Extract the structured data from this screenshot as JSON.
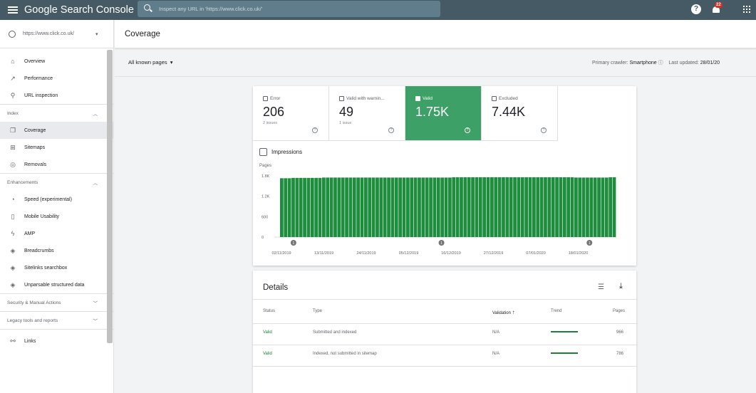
{
  "topbar": {
    "app_title": "Google Search Console",
    "search_placeholder": "Inspect any URL in 'https://www.click.co.uk/'",
    "notification_count": "22"
  },
  "sidebar": {
    "property": "https://www.click.co.uk/",
    "items_top": [
      {
        "label": "Overview",
        "icon": "home-icon",
        "glyph": "⌂"
      },
      {
        "label": "Performance",
        "icon": "trending-up-icon",
        "glyph": "↗"
      },
      {
        "label": "URL inspection",
        "icon": "search-icon",
        "glyph": "⚲"
      }
    ],
    "index_section": "Index",
    "index_items": [
      {
        "label": "Coverage",
        "icon": "file-copy-icon",
        "glyph": "❐",
        "active": true
      },
      {
        "label": "Sitemaps",
        "icon": "sitemap-icon",
        "glyph": "⊞"
      },
      {
        "label": "Removals",
        "icon": "visibility-off-icon",
        "glyph": "◎"
      }
    ],
    "enhancements_section": "Enhancements",
    "enhancement_items": [
      {
        "label": "Speed (experimental)",
        "icon": "speed-icon",
        "glyph": "◔"
      },
      {
        "label": "Mobile Usability",
        "icon": "phone-icon",
        "glyph": "▯"
      },
      {
        "label": "AMP",
        "icon": "bolt-icon",
        "glyph": "ϟ"
      },
      {
        "label": "Breadcrumbs",
        "icon": "layers-icon",
        "glyph": "◈"
      },
      {
        "label": "Sitelinks searchbox",
        "icon": "layers-icon",
        "glyph": "◈"
      },
      {
        "label": "Unparsable structured data",
        "icon": "layers-icon",
        "glyph": "◈"
      }
    ],
    "security_section": "Security & Manual Actions",
    "legacy_section": "Legacy tools and reports",
    "links_label": "Links"
  },
  "header": {
    "title": "Coverage"
  },
  "filter": {
    "pages_select": "All known pages",
    "crawler_label": "Primary crawler:",
    "crawler_value": "Smartphone",
    "last_updated_label": "Last updated:",
    "last_updated_value": "28/01/20"
  },
  "tiles": [
    {
      "label": "Error",
      "value": "206",
      "sub": "2 issues",
      "selected": false
    },
    {
      "label": "Valid with warnin...",
      "value": "49",
      "sub": "1 issue",
      "selected": false
    },
    {
      "label": "Valid",
      "value": "1.75K",
      "sub": "",
      "selected": true
    },
    {
      "label": "Excluded",
      "value": "7.44K",
      "sub": "",
      "selected": false
    }
  ],
  "impressions_label": "Impressions",
  "chart_data": {
    "type": "bar",
    "ylabel": "Pages",
    "yticks": [
      "1.8K",
      "1.2K",
      "600",
      "0"
    ],
    "ylim": [
      0,
      1800
    ],
    "xticks": [
      "02/11/2019",
      "13/11/2019",
      "24/11/2019",
      "05/12/2019",
      "16/12/2019",
      "27/12/2019",
      "07/01/2020",
      "18/01/2020"
    ],
    "annotation_markers": [
      "1",
      "1",
      "1"
    ],
    "color": "#1e8e3e",
    "values": [
      1730,
      1730,
      1730,
      1740,
      1740,
      1740,
      1740,
      1740,
      1740,
      1740,
      1740,
      1750,
      1750,
      1750,
      1750,
      1750,
      1750,
      1750,
      1750,
      1750,
      1750,
      1750,
      1750,
      1750,
      1750,
      1750,
      1750,
      1750,
      1750,
      1750,
      1750,
      1750,
      1750,
      1750,
      1750,
      1750,
      1750,
      1750,
      1750,
      1750,
      1750,
      1750,
      1750,
      1750,
      1750,
      1760,
      1760,
      1760,
      1760,
      1760,
      1760,
      1760,
      1760,
      1760,
      1760,
      1760,
      1760,
      1760,
      1760,
      1760,
      1760,
      1760,
      1760,
      1760,
      1760,
      1760,
      1760,
      1760,
      1760,
      1760,
      1760,
      1760,
      1760,
      1760,
      1760,
      1760,
      1760,
      1750,
      1750,
      1750,
      1750,
      1750,
      1750,
      1750,
      1750,
      1750,
      1760,
      1760
    ]
  },
  "details": {
    "title": "Details",
    "columns": [
      "Status",
      "Type",
      "Validation",
      "Trend",
      "Pages"
    ],
    "rows": [
      {
        "status": "Valid",
        "type": "Submitted and indexed",
        "validation": "N/A",
        "pages": "966"
      },
      {
        "status": "Valid",
        "type": "Indexed, not submitted in sitemap",
        "validation": "N/A",
        "pages": "786"
      }
    ]
  }
}
